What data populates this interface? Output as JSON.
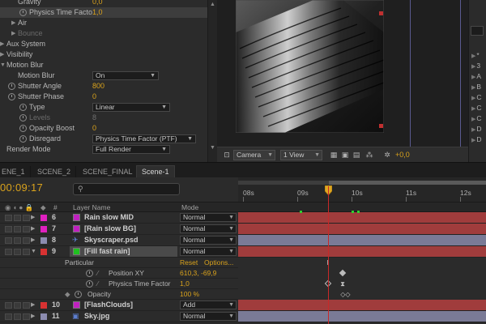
{
  "effect_controls": {
    "rows": [
      {
        "label": "Gravity",
        "value": "0,0",
        "indent": 22,
        "sel": false
      },
      {
        "label": "Physics Time Facto",
        "value": "1,0",
        "indent": 36,
        "sel": true,
        "stopwatch": true
      },
      {
        "label": "Air",
        "indent": 22,
        "twirl": "▶"
      },
      {
        "label": "Bounce",
        "indent": 22,
        "twirl": "▶",
        "dim": true
      },
      {
        "label": "Aux System",
        "indent": 8,
        "twirl": "▶"
      },
      {
        "label": "Visibility",
        "indent": 8,
        "twirl": "▶"
      },
      {
        "label": "Motion Blur",
        "indent": 8,
        "twirl": "▼"
      },
      {
        "label": "Motion Blur",
        "indent": 22,
        "dropdown": "On"
      },
      {
        "label": "Shutter Angle",
        "value": "800",
        "indent": 22,
        "stopwatch": true
      },
      {
        "label": "Shutter Phase",
        "value": "0",
        "indent": 22,
        "stopwatch": true
      },
      {
        "label": "Type",
        "indent": 36,
        "dropdown": "Linear",
        "stopwatch": true
      },
      {
        "label": "Levels",
        "value": "8",
        "indent": 36,
        "stopwatch": true,
        "dim": true
      },
      {
        "label": "Opacity Boost",
        "value": "0",
        "indent": 36,
        "stopwatch": true
      },
      {
        "label": "Disregard",
        "indent": 36,
        "dropdown": "Physics Time Factor (PTF)",
        "stopwatch": true
      },
      {
        "label": "Render Mode",
        "indent": 8,
        "dropdown": "Full Render"
      }
    ]
  },
  "viewer": {
    "camera_label": "Camera",
    "views_label": "1 View",
    "exposure": "+0,0"
  },
  "right_panel": {
    "items": [
      "*",
      "3",
      "A",
      "B",
      "C",
      "C",
      "C",
      "D",
      "D"
    ]
  },
  "tabs": [
    {
      "label": "ENE_1",
      "active": false
    },
    {
      "label": "SCENE_2",
      "active": false
    },
    {
      "label": "SCENE_FINAL",
      "active": false
    },
    {
      "label": "Scene-1",
      "active": true
    }
  ],
  "timeline": {
    "timecode": "00:09:17",
    "ruler_ticks": [
      {
        "label": "08s",
        "sec": 8
      },
      {
        "label": "09s",
        "sec": 9
      },
      {
        "label": "10s",
        "sec": 10
      },
      {
        "label": "11s",
        "sec": 11
      },
      {
        "label": "12s",
        "sec": 12
      }
    ],
    "column_headers": {
      "number": "#",
      "layer_name": "Layer Name",
      "mode": "Mode"
    },
    "layers": [
      {
        "num": "6",
        "name": "Rain slow MID",
        "color": "#e020c0",
        "mode": "Normal",
        "bar": "#a03c3c",
        "type": "solid"
      },
      {
        "num": "7",
        "name": "[Rain slow BG]",
        "color": "#e020c0",
        "mode": "Normal",
        "bar": "#a03c3c",
        "type": "solid"
      },
      {
        "num": "8",
        "name": "Skyscraper.psd",
        "color": "#8c8cb0",
        "mode": "Normal",
        "bar": "#7a7a96",
        "type": "psd"
      },
      {
        "num": "9",
        "name": "[Fill fast rain]",
        "color": "#d83232",
        "mode": "Normal",
        "bar": "#a03c3c",
        "type": "solid",
        "selected": true,
        "swatch": "#20c020"
      }
    ],
    "effect_group": {
      "name": "Particular",
      "reset": "Reset",
      "options": "Options..."
    },
    "properties": [
      {
        "name": "Position XY",
        "value": "610,3, -69,9"
      },
      {
        "name": "Physics Time Factor",
        "value": "1,0"
      },
      {
        "name": "Opacity",
        "value": "100 %"
      }
    ],
    "layers_after": [
      {
        "num": "10",
        "name": "[FlashClouds]",
        "color": "#d83232",
        "mode": "Add",
        "bar": "#a03c3c",
        "type": "solid"
      },
      {
        "num": "11",
        "name": "Sky.jpg",
        "color": "#8c8cb0",
        "mode": "Normal",
        "bar": "#7a7a96",
        "type": "jpg"
      }
    ],
    "current_time_sec": 9.57
  }
}
